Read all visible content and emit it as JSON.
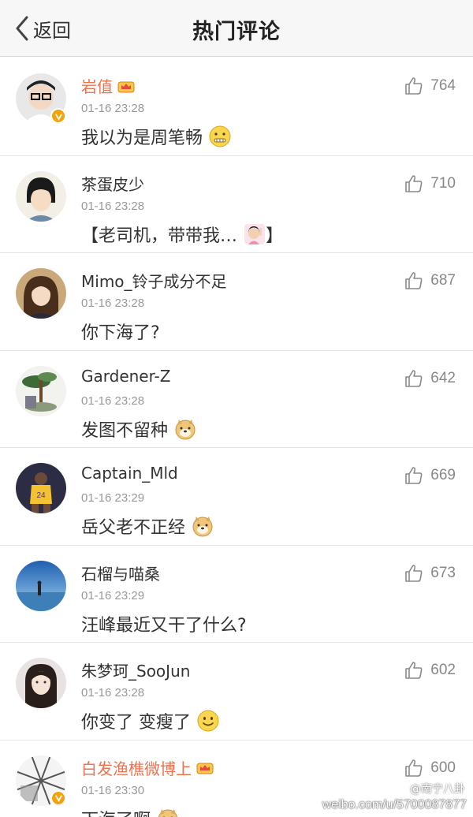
{
  "nav": {
    "back_label": "返回",
    "title": "热门评论"
  },
  "colors": {
    "vip_name": "#eb7350",
    "verified_badge": "#f2a20c",
    "secondary_text": "#999999"
  },
  "comments": [
    {
      "name": "岩值",
      "vip": true,
      "verified": true,
      "time": "01-16 23:28",
      "text": "我以为是周笔畅",
      "emoji": "zipper-mouth-emoji",
      "likes": "764"
    },
    {
      "name": "茶蛋皮少",
      "vip": false,
      "verified": false,
      "time": "01-16 23:28",
      "text": "【老司机，带带我…",
      "emoji": "girl-raising-hand-emoji",
      "text_tail": "】",
      "likes": "710"
    },
    {
      "name": "Mimo_铃子成分不足",
      "vip": false,
      "verified": false,
      "time": "01-16 23:28",
      "text": "你下海了?",
      "emoji": "",
      "likes": "687"
    },
    {
      "name": "Gardener-Z",
      "vip": false,
      "verified": false,
      "time": "01-16 23:28",
      "text": "发图不留种",
      "emoji": "doge-emoji",
      "likes": "642"
    },
    {
      "name": "Captain_Mld",
      "vip": false,
      "verified": false,
      "time": "01-16 23:29",
      "text": "岳父老不正经",
      "emoji": "doge-emoji",
      "likes": "669"
    },
    {
      "name": "石榴与喵桑",
      "vip": false,
      "verified": false,
      "time": "01-16 23:29",
      "text": "汪峰最近又干了什么?",
      "emoji": "",
      "likes": "673"
    },
    {
      "name": "朱梦珂_SooJun",
      "vip": false,
      "verified": false,
      "time": "01-16 23:28",
      "text": "你变了 变瘦了",
      "emoji": "smile-emoji",
      "likes": "602"
    },
    {
      "name": "白发渔樵微博上",
      "vip": true,
      "verified": true,
      "time": "01-16 23:30",
      "text": "下海了啊",
      "emoji": "doge-emoji",
      "likes": "600"
    }
  ],
  "watermark": {
    "line1": "@南宁八卦",
    "line2": "weibo.com/u/5700087877"
  }
}
